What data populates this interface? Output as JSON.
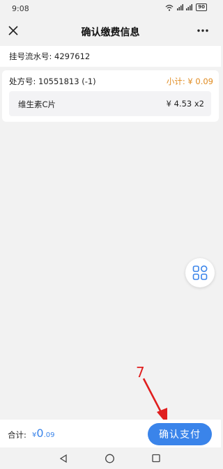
{
  "status_bar": {
    "time": "9:08",
    "signal_text": "⁴⁶ᵢₗₗ ⁴⁶ᵢₗₗ",
    "battery": "90"
  },
  "nav": {
    "title": "确认缴费信息"
  },
  "registration": {
    "label": "挂号流水号: 4297612"
  },
  "prescription": {
    "header": "处方号: 10551813 (-1)",
    "subtotal": "小计: ¥ 0.09",
    "items": [
      {
        "name": "维生素C片",
        "price": "¥ 4.53 x2"
      }
    ]
  },
  "annotation": {
    "number": "7",
    "color": "#e01e1e"
  },
  "footer": {
    "total_label": "合计:",
    "total_currency": "¥",
    "total_int": "0",
    "total_dec": ".09",
    "pay_button": "确认支付",
    "accent_color": "#3a84ea"
  },
  "icons": {
    "close": "close-icon",
    "more": "more-icon",
    "apps": "apps-grid-icon",
    "back": "back-triangle-icon",
    "home": "home-circle-icon",
    "recent": "recent-square-icon"
  }
}
